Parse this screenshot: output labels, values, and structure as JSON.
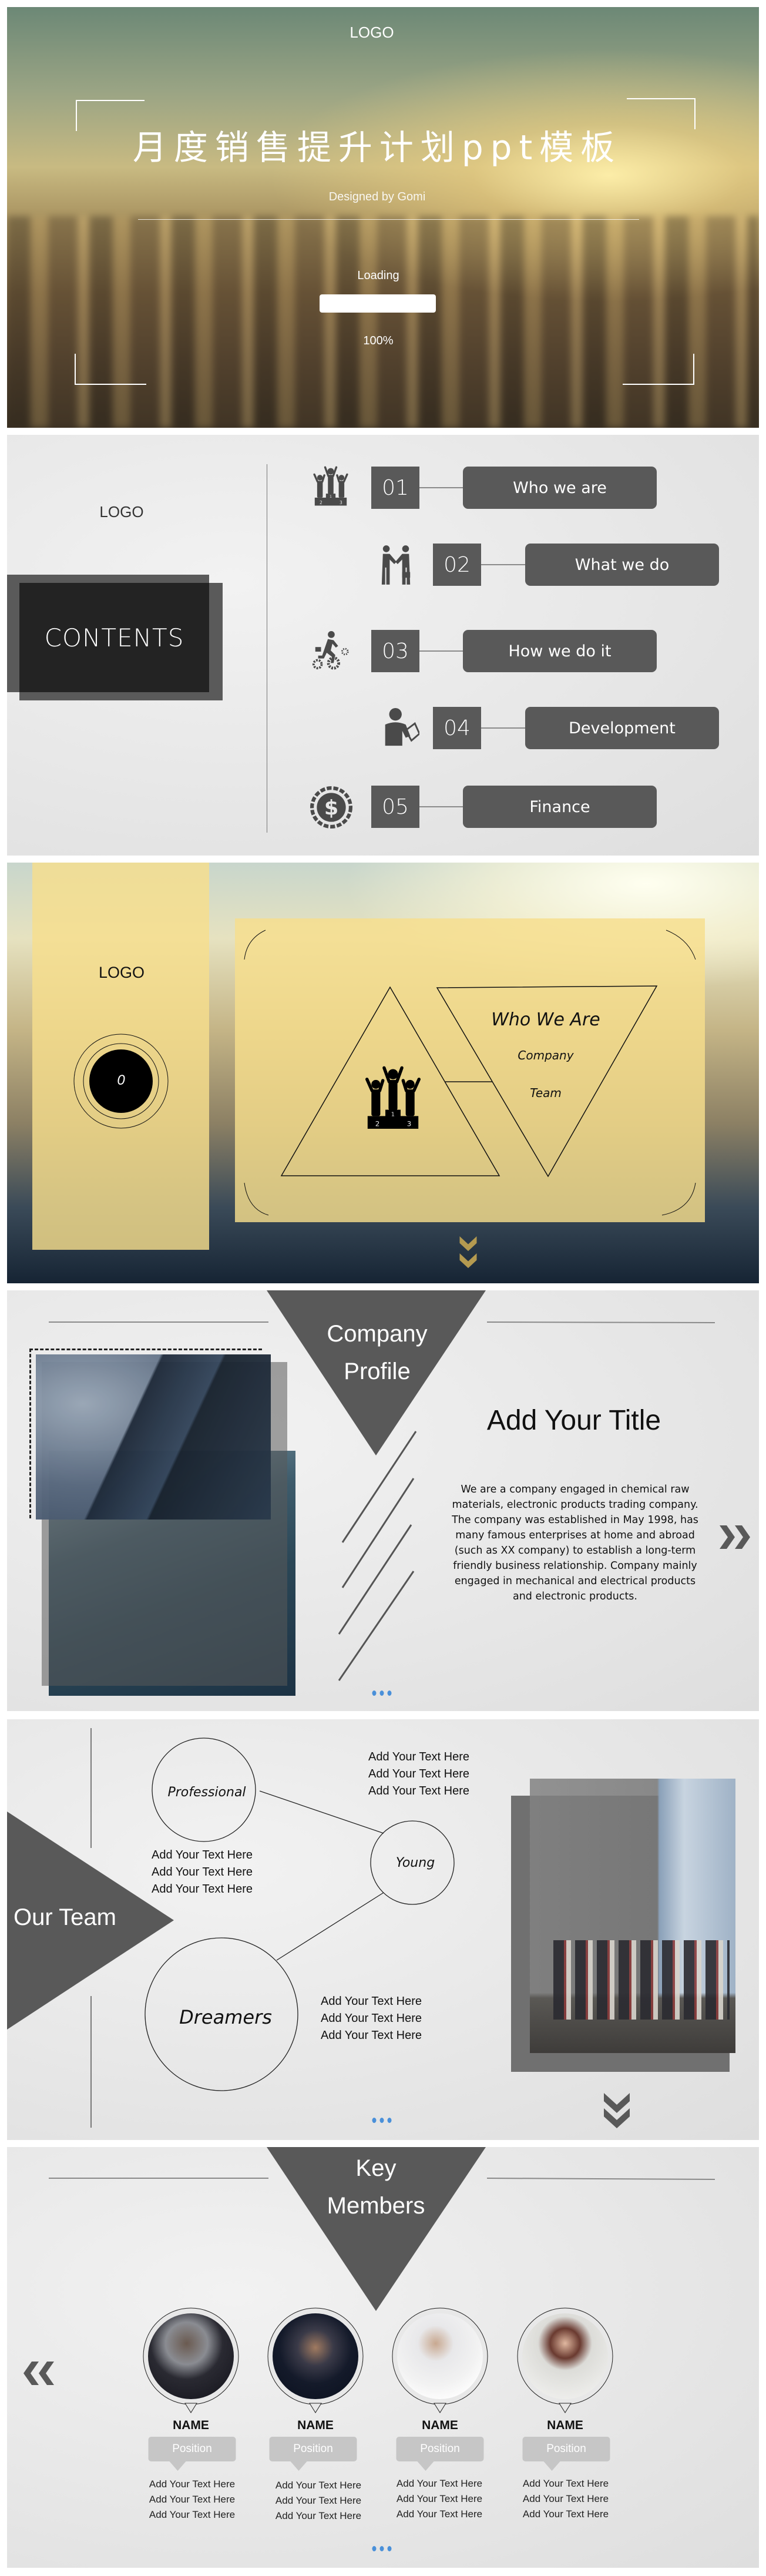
{
  "colors": {
    "dark_gray": "#595959",
    "accent_blue": "#4a90d9",
    "gold": "#b49a50",
    "panel_yellow": "#f6de8c",
    "pill_gray": "#c6c6c6"
  },
  "slide1": {
    "logo": "LOGO",
    "title": "月度销售提升计划ppt模板",
    "subtitle": "Designed by Gomi",
    "loading_label": "Loading",
    "progress_percent": 100,
    "progress_text": "100%"
  },
  "slide2": {
    "logo": "LOGO",
    "heading": "CONTENTS",
    "items": [
      {
        "number": "01",
        "label": "Who we are",
        "icon": "podium-icon"
      },
      {
        "number": "02",
        "label": "What we do",
        "icon": "handshake-icon"
      },
      {
        "number": "03",
        "label": "How we do it",
        "icon": "runner-gears-icon"
      },
      {
        "number": "04",
        "label": "Development",
        "icon": "presenter-icon"
      },
      {
        "number": "05",
        "label": "Finance",
        "icon": "dollar-coin-icon"
      }
    ]
  },
  "slide3": {
    "logo": "LOGO",
    "badge": "0",
    "title": "Who We Are",
    "line1": "Company",
    "line2": "Team",
    "icon": "podium-icon"
  },
  "slide4": {
    "header_line1": "Company",
    "header_line2": "Profile",
    "title": "Add Your Title",
    "body": "We are a company engaged in chemical raw materials, electronic products trading company. The company was established in May 1998, has many famous enterprises at home and abroad (such as XX company) to establish a long-term friendly business relationship. Company mainly engaged in mechanical and electrical products and electronic products.",
    "next_icon": "chevron-right-double-icon"
  },
  "slide5": {
    "header": "Our Team",
    "circles": [
      "Professional",
      "Young",
      "Dreamers"
    ],
    "text_top": [
      "Add Your Text Here",
      "Add Your Text Here",
      "Add Your Text Here"
    ],
    "text_left": [
      "Add Your Text Here",
      "Add Your Text Here",
      "Add Your Text Here"
    ],
    "text_bottom": [
      "Add Your Text Here",
      "Add Your Text Here",
      "Add Your Text Here"
    ],
    "down_icon": "chevron-down-double-icon"
  },
  "slide6": {
    "header_line1": "Key",
    "header_line2": "Members",
    "prev_icon": "chevron-left-double-icon",
    "members": [
      {
        "name": "NAME",
        "position": "Position",
        "lines": [
          "Add Your Text Here",
          "Add Your Text Here",
          "Add Your Text Here"
        ]
      },
      {
        "name": "NAME",
        "position": "Position",
        "lines": [
          "Add Your Text Here",
          "Add Your Text Here",
          "Add Your Text Here"
        ]
      },
      {
        "name": "NAME",
        "position": "Position",
        "lines": [
          "Add Your Text Here",
          "Add Your Text Here",
          "Add Your Text Here"
        ]
      },
      {
        "name": "NAME",
        "position": "Position",
        "lines": [
          "Add Your Text Here",
          "Add Your Text Here",
          "Add Your Text Here"
        ]
      }
    ]
  }
}
